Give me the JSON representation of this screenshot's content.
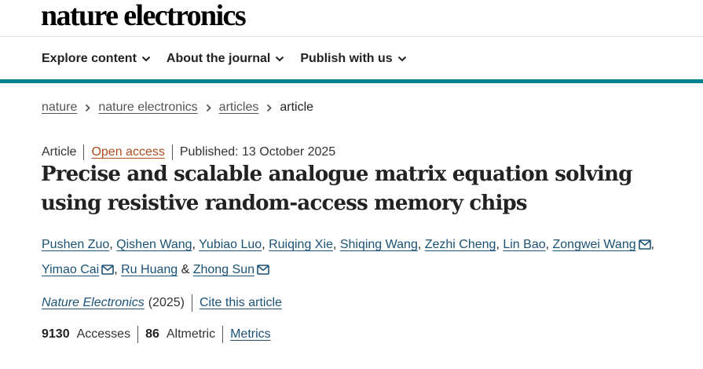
{
  "site": {
    "logo": "nature electronics"
  },
  "nav": {
    "items": [
      {
        "label": "Explore content"
      },
      {
        "label": "About the journal"
      },
      {
        "label": "Publish with us"
      }
    ]
  },
  "breadcrumb": {
    "items": [
      "nature",
      "nature electronics",
      "articles"
    ],
    "current": "article"
  },
  "article": {
    "type": "Article",
    "access": "Open access",
    "published": "Published: 13 October 2025",
    "title": "Precise and scalable analogue matrix equation solving using resistive random-access memory chips",
    "authors": [
      {
        "name": "Pushen Zuo",
        "sep": ", "
      },
      {
        "name": "Qishen Wang",
        "sep": ", "
      },
      {
        "name": "Yubiao Luo",
        "sep": ", "
      },
      {
        "name": "Ruiqing Xie",
        "sep": ", "
      },
      {
        "name": "Shiqing Wang",
        "sep": ", "
      },
      {
        "name": "Zezhi Cheng",
        "sep": ", "
      },
      {
        "name": "Lin Bao",
        "sep": ", "
      },
      {
        "name": "Zongwei Wang",
        "sep": ", "
      },
      {
        "name": "Yimao Cai",
        "sep": ", "
      },
      {
        "name": "Ru Huang",
        "sep": " & "
      },
      {
        "name": "Zhong Sun",
        "sep": ""
      }
    ],
    "journal": "Nature Electronics",
    "year": "(2025)",
    "cite_label": "Cite this article"
  },
  "metrics": {
    "accesses_count": "9130",
    "accesses_label": "Accesses",
    "altmetric_count": "86",
    "altmetric_label": "Altmetric",
    "link_label": "Metrics"
  },
  "colors": {
    "accent_bar": "#00838f",
    "link": "#1a5276",
    "open_access": "#b04a1f"
  },
  "icons": {
    "nav_dropdown": "chevron-down-icon",
    "breadcrumb_separator": "chevron-right-icon",
    "author_contact": "mail-icon"
  }
}
